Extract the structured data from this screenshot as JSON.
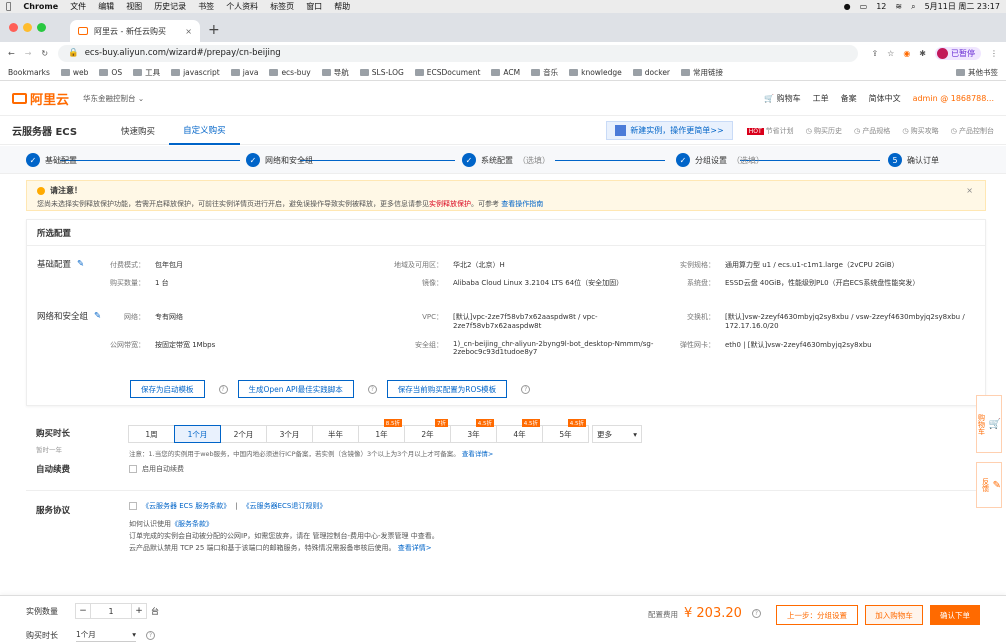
{
  "mac": {
    "apple": "",
    "app": "Chrome",
    "menus": [
      "文件",
      "编辑",
      "视图",
      "历史记录",
      "书签",
      "个人资料",
      "标签页",
      "窗口",
      "帮助"
    ],
    "battery": "12",
    "clock": "5月11日 周二 23:17"
  },
  "browser": {
    "tab_title": "阿里云 - 新任云购买",
    "url": "ecs-buy.aliyun.com/wizard#/prepay/cn-beijing",
    "profile": "已暂停"
  },
  "bookmarks": {
    "items": [
      "Bookmarks",
      "web",
      "OS",
      "工具",
      "javascript",
      "java",
      "ecs-buy",
      "导航",
      "SLS-LOG",
      "ECSDocument",
      "ACM",
      "音乐",
      "knowledge",
      "docker",
      "常用链接"
    ],
    "other": "其他书签"
  },
  "topnav": {
    "logo": "阿里云",
    "workspace": "华东金融控制台",
    "cart": "购物车",
    "ticket": "工单",
    "record": "备案",
    "lang": "简体中文",
    "account": "admin @ 1868788..."
  },
  "subnav": {
    "product": "云服务器 ECS",
    "tabs": [
      "快速购买",
      "自定义购买"
    ],
    "active": 1,
    "promo": "新建实例，操作更简单>>",
    "links": [
      "节省计划",
      "购买历史",
      "产品规格",
      "购买攻略",
      "产品控制台"
    ],
    "hot": "HOT"
  },
  "steps": [
    {
      "label": "基础配置",
      "opt": ""
    },
    {
      "label": "网络和安全组",
      "opt": ""
    },
    {
      "label": "系统配置",
      "opt": "（选填）"
    },
    {
      "label": "分组设置",
      "opt": "（选填）"
    },
    {
      "num": "5",
      "label": "确认订单",
      "opt": ""
    }
  ],
  "notice": {
    "title": "请注意！",
    "body_a": "您尚未选择实例释放保护功能，若需开启释放保护，可前往实例详情页进行开启，避免误操作导致实例被释放，更多信息请参见",
    "red": "实例释放保护",
    "body_b": "。可参考",
    "link": "查看操作指南"
  },
  "config": {
    "title": "所选配置",
    "basic_label": "基础配置",
    "net_label": "网络和安全组",
    "basic": [
      {
        "k": "付费模式：",
        "v": "包年包月"
      },
      {
        "k": "地域及可用区：",
        "v": "华北2（北京）H"
      },
      {
        "k": "实例规格：",
        "v": "通用算力型 u1 / ecs.u1-c1m1.large（2vCPU 2GiB）"
      },
      {
        "k": "购买数量：",
        "v": "1 台"
      },
      {
        "k": "镜像：",
        "v": "Alibaba Cloud Linux 3.2104 LTS 64位（安全加固）"
      },
      {
        "k": "系统盘：",
        "v": "ESSD云盘 40GiB，性能级别PL0（开启ECS系统盘性能突发）"
      }
    ],
    "net": [
      {
        "k": "网络：",
        "v": "专有网络"
      },
      {
        "k": "VPC：",
        "v": "[默认]vpc-2ze7f58vb7x62aaspdw8t / vpc-2ze7f58vb7x62aaspdw8t"
      },
      {
        "k": "交换机：",
        "v": "[默认]vsw-2zeyf4630mbyjq2sy8xbu / vsw-2zeyf4630mbyjq2sy8xbu / 172.17.16.0/20"
      },
      {
        "k": "公网带宽：",
        "v": "按固定带宽 1Mbps"
      },
      {
        "k": "安全组：",
        "v": "1)_cn-beijing_chr-aliyun-2byng9l-bot_desktop-Nmmm/sg-2zeboc9c93d1tudoe8y7"
      },
      {
        "k": "弹性网卡：",
        "v": "eth0 | [默认]vsw-2zeyf4630mbyjq2sy8xbu"
      }
    ],
    "buttons": [
      "保存为启动模板",
      "生成Open API最佳实践脚本",
      "保存当前购买配置为ROS模板"
    ]
  },
  "duration": {
    "label": "购买时长",
    "sub": "暂时一年",
    "options": [
      "1周",
      "1个月",
      "2个月",
      "3个月",
      "半年",
      "1年",
      "2年",
      "3年",
      "4年",
      "5年"
    ],
    "tags": [
      "",
      "",
      "",
      "",
      "",
      "8.5折",
      "7折",
      "4.5折",
      "4.5折",
      "4.5折"
    ],
    "active": 1,
    "more": "更多",
    "note": "注意：1.当您的实例用于web服务，中国内地必须进行ICP备案，若实例（含镜像）3个以上为3个月以上才可备案。",
    "note_link": "查看详情>"
  },
  "autorenew": {
    "label": "自动续费",
    "check": "启用自动续费"
  },
  "agreement": {
    "label": "服务协议",
    "check_a": "《云服务器 ECS 服务条款》",
    "sep": " | ",
    "check_b": "《云服务器ECS退订规则》",
    "l1a": "如何认识使用",
    "l1b": "《服务条款》",
    "l2": "订单完成的实例会自动被分配的公网IP，如需您放弃，请在 管理控制台-费用中心-发票管理 中查看。",
    "l3a": "云产品默认禁用 TCP 25 端口和基于该端口的邮箱服务，特殊情况需报备审核后使用。",
    "l3b": "查看详情>"
  },
  "footer": {
    "qty_label": "实例数量",
    "qty": "1",
    "unit": "台",
    "dur_label": "购买时长",
    "dur": "1个月",
    "price_label": "配置费用",
    "price": "¥ 203.20",
    "prev": "上一步：分组设置",
    "cart": "加入购物车",
    "go": "确认下单"
  },
  "side": {
    "cart": "购物车",
    "feedback": "反馈"
  },
  "colors": {
    "accent": "#ff6a00",
    "link": "#0064c8"
  }
}
